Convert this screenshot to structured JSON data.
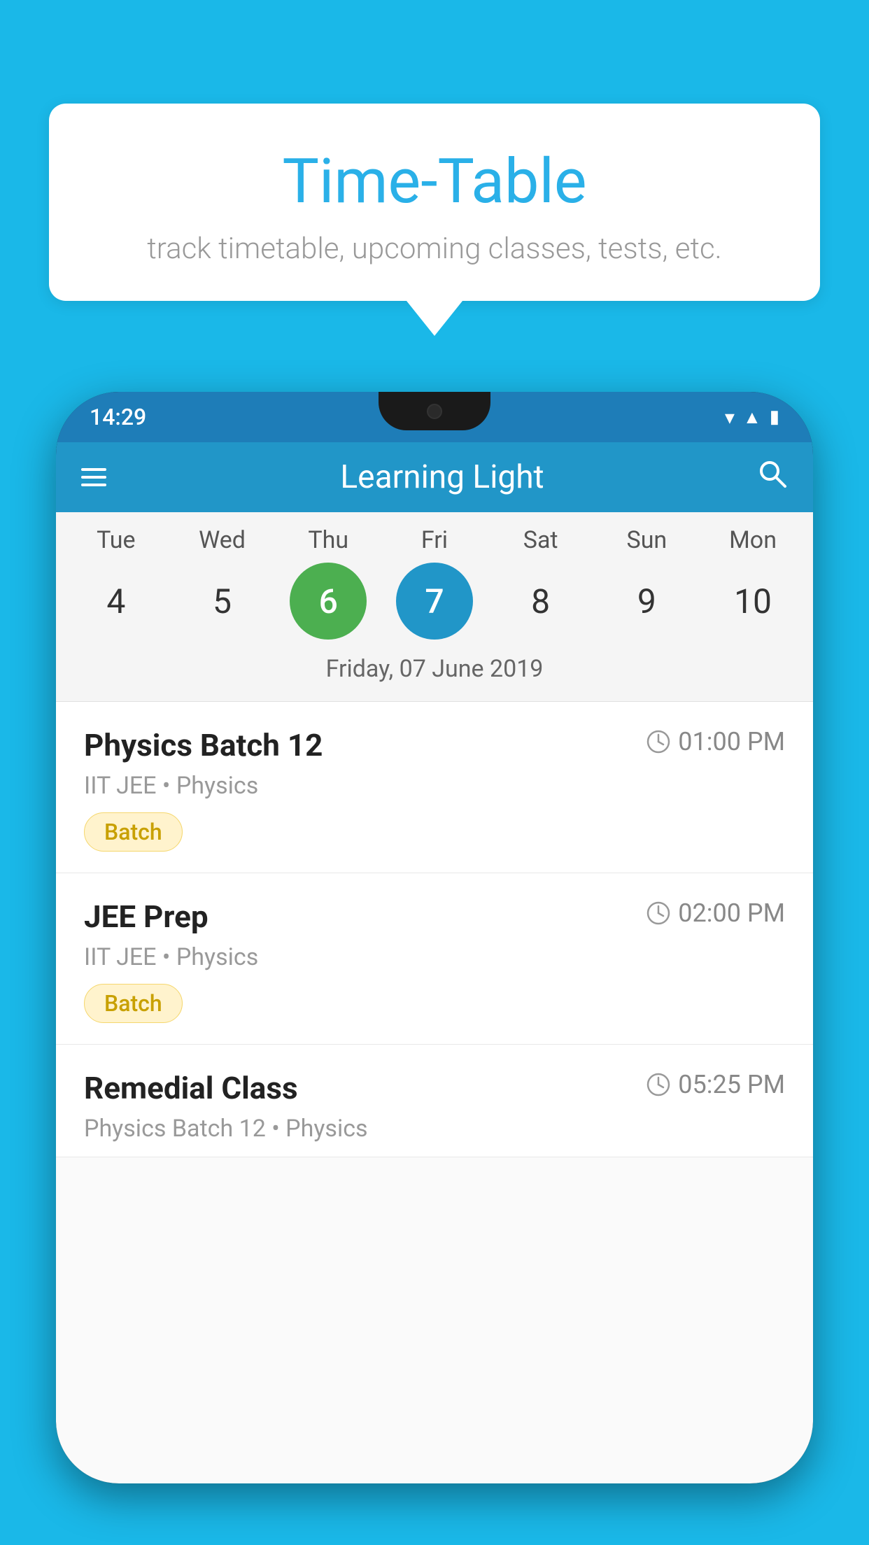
{
  "background_color": "#1ab8e8",
  "speech_bubble": {
    "title": "Time-Table",
    "subtitle": "track timetable, upcoming classes, tests, etc."
  },
  "phone": {
    "status_bar": {
      "time": "14:29"
    },
    "app_bar": {
      "title": "Learning Light"
    },
    "calendar": {
      "days": [
        {
          "name": "Tue",
          "num": "4",
          "state": "normal"
        },
        {
          "name": "Wed",
          "num": "5",
          "state": "normal"
        },
        {
          "name": "Thu",
          "num": "6",
          "state": "today"
        },
        {
          "name": "Fri",
          "num": "7",
          "state": "selected"
        },
        {
          "name": "Sat",
          "num": "8",
          "state": "normal"
        },
        {
          "name": "Sun",
          "num": "9",
          "state": "normal"
        },
        {
          "name": "Mon",
          "num": "10",
          "state": "normal"
        }
      ],
      "selected_date_label": "Friday, 07 June 2019"
    },
    "classes": [
      {
        "name": "Physics Batch 12",
        "time": "01:00 PM",
        "subtitle": "IIT JEE • Physics",
        "badge": "Batch"
      },
      {
        "name": "JEE Prep",
        "time": "02:00 PM",
        "subtitle": "IIT JEE • Physics",
        "badge": "Batch"
      },
      {
        "name": "Remedial Class",
        "time": "05:25 PM",
        "subtitle": "Physics Batch 12 • Physics",
        "badge": null
      }
    ]
  }
}
